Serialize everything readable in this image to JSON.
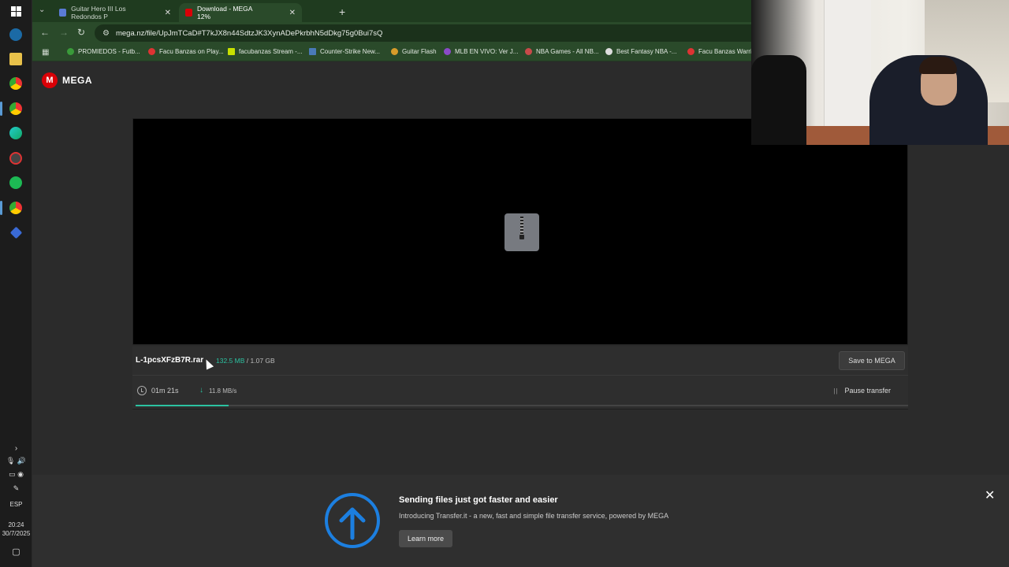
{
  "taskbar": {
    "language": "ESP",
    "time": "20:24",
    "date": "30/7/2025",
    "icons": [
      "windows-start-icon",
      "steam-icon",
      "file-explorer-icon",
      "chrome-icon",
      "chrome-profile-icon",
      "edge-icon",
      "chrome-profile-icon-2",
      "spotify-icon",
      "chrome-profile-icon-3",
      "app-icon"
    ]
  },
  "tabs": [
    {
      "title": "Guitar Hero III Los Redondos P",
      "active": false,
      "fav_color": "#5a7bd5"
    },
    {
      "title": "Download - MEGA 12%",
      "active": true,
      "fav_color": "#d90007"
    }
  ],
  "toolbar": {
    "url": "mega.nz/file/UpJmTCaD#T7kJX8n44SdtzJK3XynADePkrbhN5dDkg75g0Bui7sQ"
  },
  "bookmarks": [
    {
      "label": "PROMIEDOS - Futb...",
      "color": "#3a9a3a"
    },
    {
      "label": "Facu Banzas on Play...",
      "color": "#d33"
    },
    {
      "label": "facubanzas Stream -...",
      "color": "#c8e000"
    },
    {
      "label": "Counter-Strike New...",
      "color": "#4a7ab8"
    },
    {
      "label": "Guitar Flash",
      "color": "#d89b2a"
    },
    {
      "label": "MLB EN VIVO: Ver J...",
      "color": "#8a4ac8"
    },
    {
      "label": "NBA Games - All NB...",
      "color": "#c84a4a"
    },
    {
      "label": "Best Fantasy NBA -...",
      "color": "#ddd"
    },
    {
      "label": "Facu Banzas Warrio",
      "color": "#d33"
    }
  ],
  "brand": {
    "logo_letter": "M",
    "name": "MEGA"
  },
  "download": {
    "file_name": "L-1pcsXFzB7R.rar",
    "downloaded": "132.5 MB",
    "separator": "/",
    "total": "1.07 GB",
    "eta": "01m 21s",
    "speed": "11.8 MB/s",
    "progress": 0.12,
    "save_label": "Save to MEGA",
    "pause_label": "Pause transfer"
  },
  "banner": {
    "title": "Sending files just got faster and easier",
    "text": "Introducing Transfer.it - a new, fast and simple file transfer service, powered by MEGA",
    "button": "Learn more",
    "accent": "#1c7fe0"
  },
  "colors": {
    "accent": "#2bc1a0",
    "brand": "#d90007"
  }
}
